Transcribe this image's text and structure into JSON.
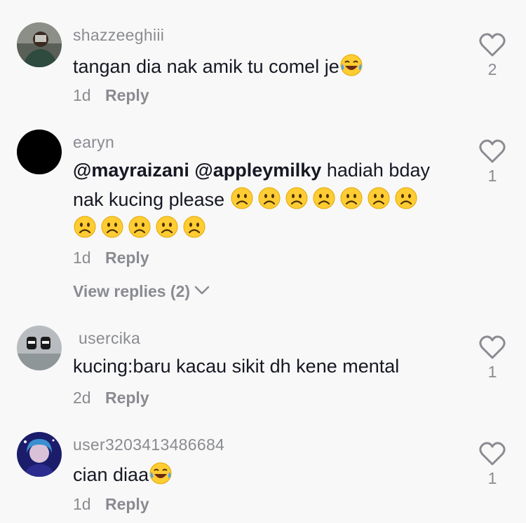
{
  "comments": [
    {
      "username": "shazzeeghiii",
      "text": "tangan dia nak amik tu comel je",
      "emoji": "laughing-tears",
      "time": "1d",
      "reply": "Reply",
      "likes": "2"
    },
    {
      "username": "earyn",
      "mention1": "@mayraizani",
      "mention2": "@appleymilky",
      "text1": "hadiah bday",
      "text2": "nak kucing please",
      "emoji": "frowning-face",
      "emoji_count": 12,
      "time": "1d",
      "reply": "Reply",
      "likes": "1",
      "view_replies": "View replies (2)"
    },
    {
      "username": "usercika",
      "text": "kucing:baru kacau sikit dh kene mental",
      "time": "2d",
      "reply": "Reply",
      "likes": "1"
    },
    {
      "username": "user3203413486684",
      "text": "cian diaa",
      "emoji": "laughing-tears",
      "time": "1d",
      "reply": "Reply",
      "likes": "1"
    }
  ],
  "colors": {
    "background": "#f8f8f8",
    "primary_text": "#161823",
    "secondary_text": "#8a8b91"
  }
}
